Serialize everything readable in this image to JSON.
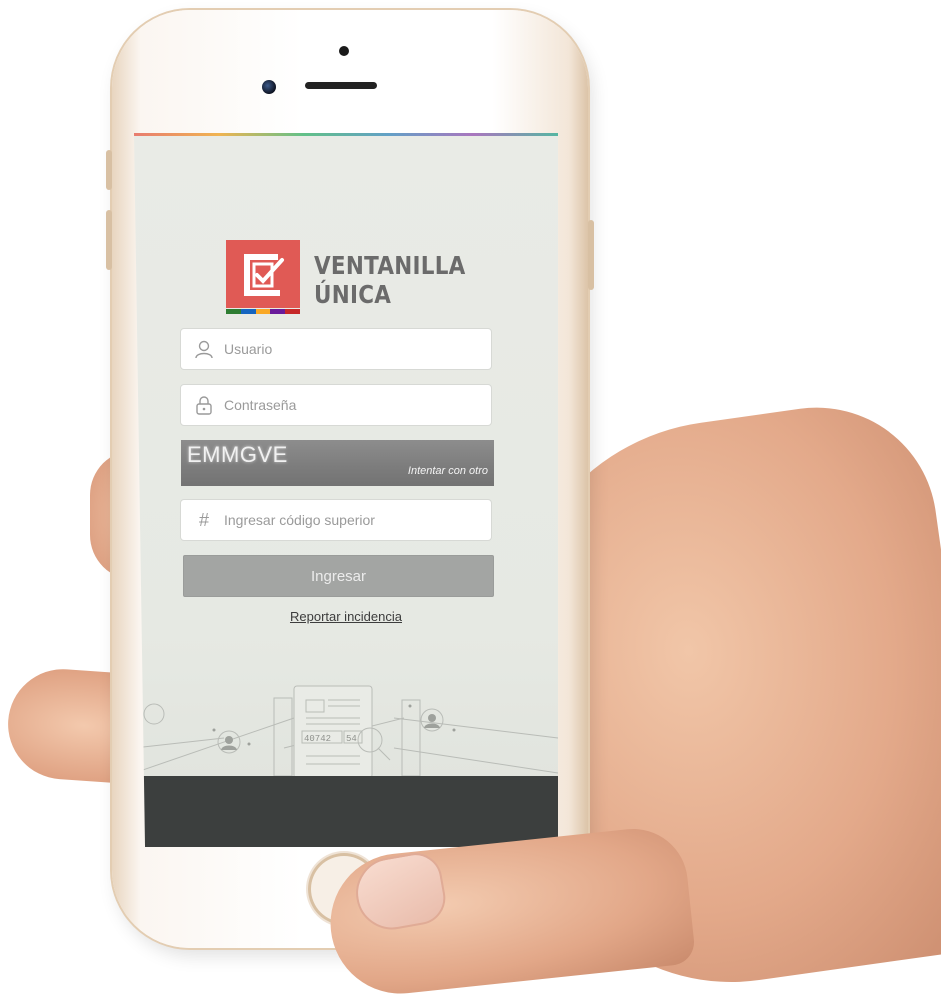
{
  "brand": {
    "line1": "VENTANILLA",
    "line2": "ÚNICA",
    "stripe_colors": [
      "#2e7d32",
      "#1565c0",
      "#f9a825",
      "#6a1b9a",
      "#c62828"
    ]
  },
  "login_form": {
    "username": {
      "placeholder": "Usuario",
      "value": ""
    },
    "password": {
      "placeholder": "Contraseña",
      "value": ""
    },
    "captcha": {
      "code": "EMMGVE",
      "retry_label": "Intentar con otro"
    },
    "captcha_input": {
      "placeholder": "Ingresar código superior",
      "value": ""
    },
    "submit_label": "Ingresar",
    "report_link": "Reportar incidencia"
  },
  "illustration": {
    "number_left": "40742",
    "number_right": "54"
  },
  "colors": {
    "accent_red": "#e05a55",
    "button_gray": "#a3a5a3",
    "footer": "#3c3f3e"
  }
}
